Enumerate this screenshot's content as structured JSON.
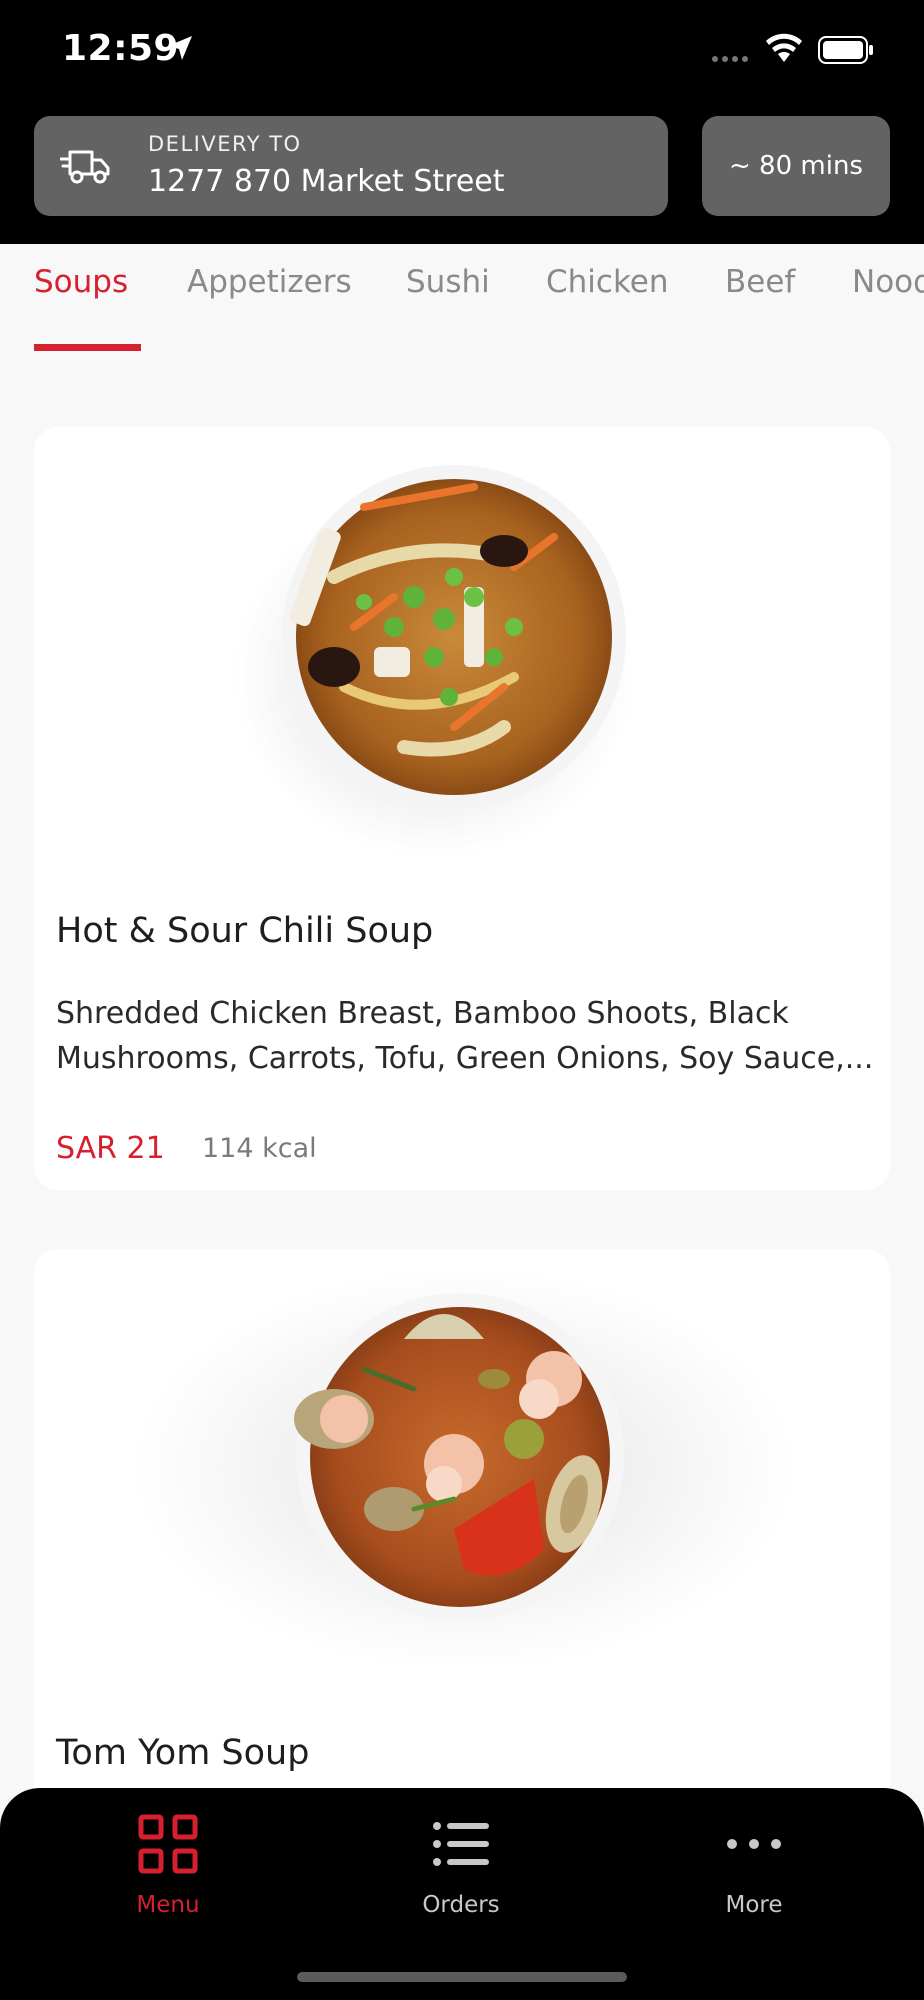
{
  "status_bar": {
    "time": "12:59"
  },
  "header": {
    "delivery_label": "DELIVERY TO",
    "delivery_address": "1277 870 Market Street",
    "eta": "~ 80 mins"
  },
  "tabs": [
    {
      "label": "Soups",
      "active": true
    },
    {
      "label": "Appetizers",
      "active": false
    },
    {
      "label": "Sushi",
      "active": false
    },
    {
      "label": "Chicken",
      "active": false
    },
    {
      "label": "Beef",
      "active": false
    },
    {
      "label": "Noodles",
      "active": false
    }
  ],
  "items": [
    {
      "title": "Hot & Sour Chili Soup",
      "description_line1": "Shredded Chicken Breast, Bamboo Shoots, Black",
      "description_line2": "Mushrooms, Carrots, Tofu, Green Onions,  Soy Sauce,...",
      "price": "SAR 21",
      "kcal": "114 kcal"
    },
    {
      "title": "Tom Yom Soup"
    }
  ],
  "bottom_nav": [
    {
      "label": "Menu",
      "icon": "grid-icon",
      "active": true
    },
    {
      "label": "Orders",
      "icon": "list-icon",
      "active": false
    },
    {
      "label": "More",
      "icon": "more-dots-icon",
      "active": false
    }
  ],
  "colors": {
    "accent": "#d6202f",
    "header_bg": "#000000",
    "header_box": "#636363",
    "page_bg": "#f8f8f8"
  }
}
